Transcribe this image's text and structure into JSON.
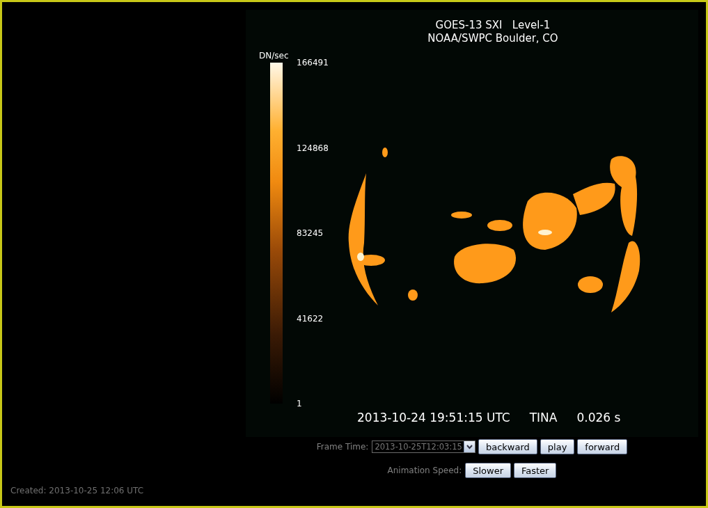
{
  "image": {
    "title_lines": [
      "GOES-13 SXI   Level-1",
      "NOAA/SWPC Boulder, CO"
    ],
    "colorbar": {
      "unit": "DN/sec",
      "ticks": [
        "166491",
        "124868",
        "83245",
        "41622",
        "1"
      ]
    },
    "caption": [
      "2013-10-24 19:51:15 UTC",
      "TINA",
      "0.026 s"
    ]
  },
  "controls": {
    "frame_time_label": "Frame Time:",
    "frame_time_value": "2013-10-25T12:03:15",
    "buttons": [
      "backward",
      "play",
      "forward"
    ],
    "speed_label": "Animation Speed:",
    "speed_buttons": [
      "Slower",
      "Faster"
    ]
  },
  "footer": {
    "created": "Created: 2013-10-25 12:06 UTC"
  }
}
